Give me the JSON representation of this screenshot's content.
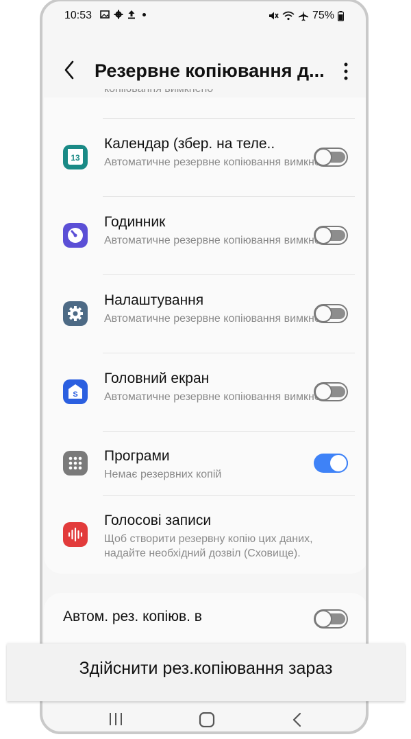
{
  "status_bar": {
    "time": "10:53",
    "left_icons": [
      "image-icon",
      "gear-icon",
      "upload-icon",
      "dot-icon"
    ],
    "right_icons": [
      "mute-icon",
      "wifi-icon",
      "airplane-icon"
    ],
    "battery": "75%"
  },
  "header": {
    "title": "Резервне копіювання д..."
  },
  "partial_top_text": "копіювання вимкнено",
  "items": [
    {
      "title": "Календар (збер. на теле..",
      "subtitle": "Автоматичне резервне копіювання вимкнено",
      "icon": "calendar-icon",
      "icon_text": "13",
      "icon_color": "#1a8a86",
      "toggle": false
    },
    {
      "title": "Годинник",
      "subtitle": "Автоматичне резервне копіювання вимкнено",
      "icon": "clock-icon",
      "icon_color": "#5b4fd6",
      "toggle": false
    },
    {
      "title": "Налаштування",
      "subtitle": "Автоматичне резервне копіювання вимкнено",
      "icon": "settings-icon",
      "icon_color": "#4d6a85",
      "toggle": false
    },
    {
      "title": "Головний екран",
      "subtitle": "Автоматичне резервне копіювання вимкнено",
      "icon": "home-screen-icon",
      "icon_color": "#2b5fe0",
      "toggle": false
    },
    {
      "title": "Програми",
      "subtitle": "Немає резервних копій",
      "icon": "apps-icon",
      "icon_color": "#7a7a7a",
      "toggle": true
    },
    {
      "title": "Голосові записи",
      "subtitle": "Щоб створити резервну копію цих даних, надайте необхідний дозвіл (Сховище).",
      "icon": "voice-recorder-icon",
      "icon_color": "#e23b3b",
      "toggle": null
    }
  ],
  "auto_backup": {
    "label": "Автом. рез. копіюв. в",
    "toggle": false
  },
  "action_button": "Здійснити рез.копіювання зараз",
  "colors": {
    "accent": "#3e82f7"
  }
}
